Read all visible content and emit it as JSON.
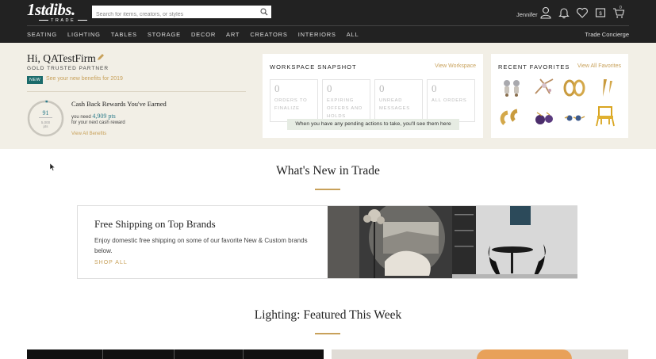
{
  "header": {
    "logo": "1stdibs.",
    "logo_sub": "TRADE",
    "search_placeholder": "Search for items, creators, or styles",
    "username": "Jennifer",
    "cart_count": "0",
    "nav": [
      "SEATING",
      "LIGHTING",
      "TABLES",
      "STORAGE",
      "DECOR",
      "ART",
      "CREATORS",
      "INTERIORS",
      "ALL"
    ],
    "concierge": "Trade Concierge"
  },
  "dashboard": {
    "greeting": "Hi, QATestFirm",
    "partner": "GOLD TRUSTED PARTNER",
    "new_badge": "NEW",
    "benefits_link": "See your new benefits for 2019",
    "points_current": "91",
    "points_total": "5,000",
    "points_unit": "pts",
    "cashback_title": "Cash Back Rewards You've Earned",
    "need_prefix": "you need",
    "need_points": "4,909 pts",
    "need_suffix": "for your next cash reward",
    "view_benefits": "View All Benefits"
  },
  "workspace": {
    "title": "WORKSPACE SNAPSHOT",
    "link": "View Workspace",
    "boxes": [
      {
        "num": "0",
        "label": "ORDERS TO FINALIZE"
      },
      {
        "num": "0",
        "label": "EXPIRING OFFERS AND HOLDS"
      },
      {
        "num": "0",
        "label": "UNREAD MESSAGES"
      },
      {
        "num": "0",
        "label": "ALL ORDERS"
      }
    ],
    "tip": "When you have any pending actions to take, you'll see them here"
  },
  "favorites": {
    "title": "RECENT FAVORITES",
    "link": "View All Favorites"
  },
  "whats_new": {
    "title": "What's New in Trade",
    "promo_title": "Free Shipping on Top Brands",
    "promo_desc": "Enjoy domestic free shipping on some of our favorite New & Custom brands below.",
    "promo_link": "SHOP ALL"
  },
  "featured": {
    "title": "Lighting: Featured This Week"
  },
  "colors": {
    "header_bg": "#222222",
    "accent_gold": "#c8a15a",
    "teal": "#1b6b6b",
    "dash_bg": "#f2efe6"
  }
}
